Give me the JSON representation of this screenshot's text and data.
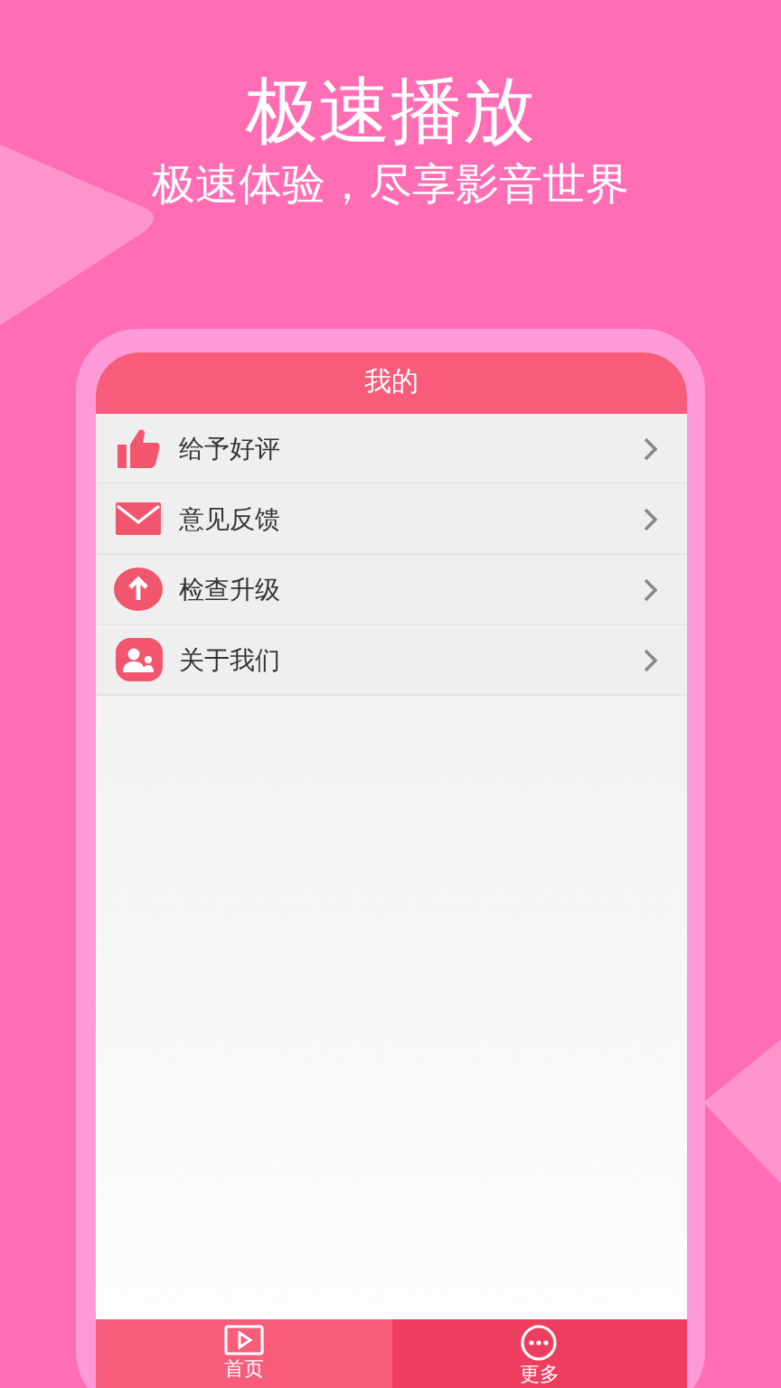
{
  "banner": {
    "title": "极速播放",
    "subtitle": "极速体验，尽享影音世界"
  },
  "screen": {
    "title": "我的",
    "menu": [
      {
        "kind": "like",
        "label": "给予好评"
      },
      {
        "kind": "mail",
        "label": "意见反馈"
      },
      {
        "kind": "upgrade",
        "label": "检查升级"
      },
      {
        "kind": "about",
        "label": "关于我们"
      }
    ],
    "tabs": [
      {
        "kind": "home",
        "label": "首页",
        "selected": false
      },
      {
        "kind": "more",
        "label": "更多",
        "selected": true
      }
    ]
  }
}
